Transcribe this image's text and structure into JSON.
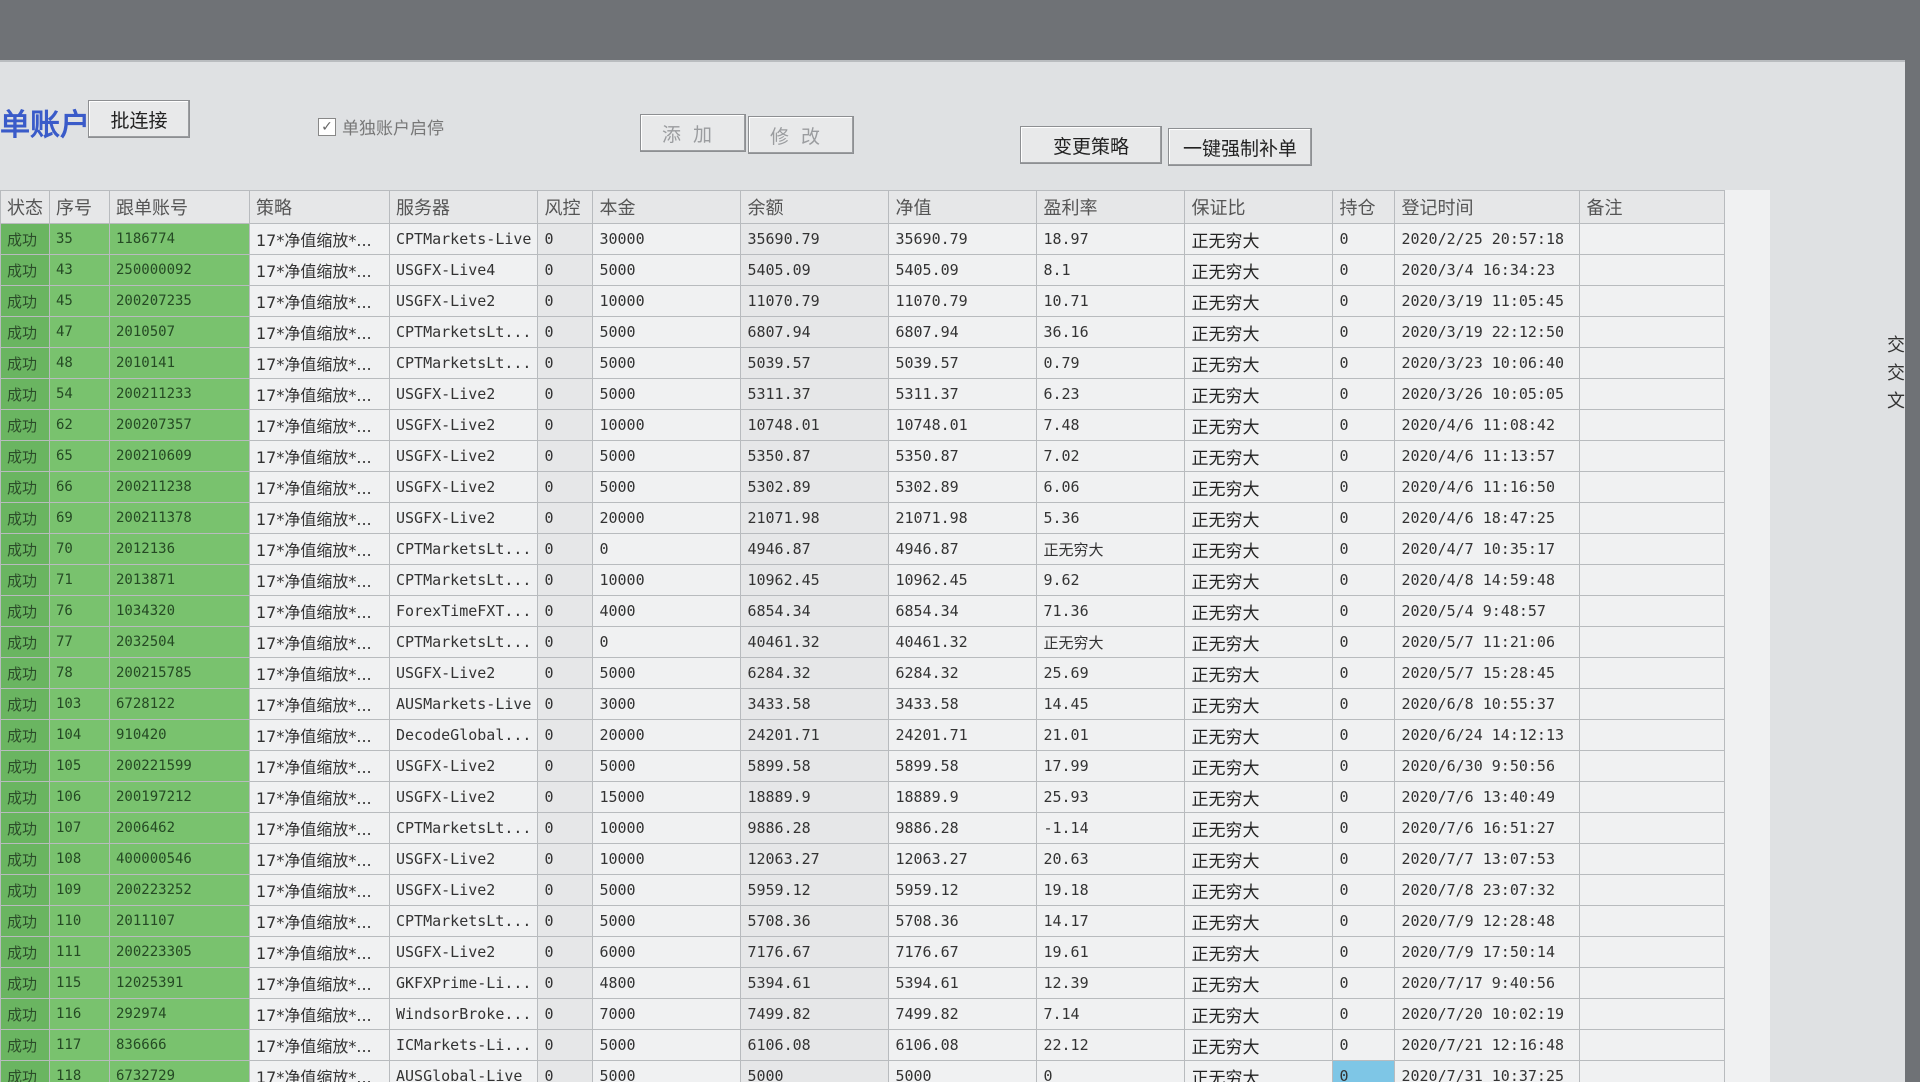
{
  "toolbar": {
    "title": "单账户",
    "batch_connect": "批连接",
    "independent_checkbox": "单独账户启停",
    "checkbox_checked": true,
    "add": "添加",
    "edit": "修改",
    "change_strategy": "变更策略",
    "force_fill": "一键强制补单"
  },
  "columns": [
    "状态",
    "序号",
    "跟单账号",
    "策略",
    "服务器",
    "风控",
    "本金",
    "余额",
    "净值",
    "盈利率",
    "保证比",
    "持仓",
    "登记时间",
    "备注"
  ],
  "rows": [
    {
      "status": "成功",
      "seq": "35",
      "account": "1186774",
      "strategy": "17*净值缩放*...",
      "server": "CPTMarkets-Live",
      "risk": "0",
      "principal": "30000",
      "balance": "35690.79",
      "equity": "35690.79",
      "profit": "18.97",
      "margin": "正无穷大",
      "pos": "0",
      "time": "2020/2/25 20:57:18",
      "note": ""
    },
    {
      "status": "成功",
      "seq": "43",
      "account": "250000092",
      "strategy": "17*净值缩放*...",
      "server": "USGFX-Live4",
      "risk": "0",
      "principal": "5000",
      "balance": "5405.09",
      "equity": "5405.09",
      "profit": "8.1",
      "margin": "正无穷大",
      "pos": "0",
      "time": "2020/3/4 16:34:23",
      "note": ""
    },
    {
      "status": "成功",
      "seq": "45",
      "account": "200207235",
      "strategy": "17*净值缩放*...",
      "server": "USGFX-Live2",
      "risk": "0",
      "principal": "10000",
      "balance": "11070.79",
      "equity": "11070.79",
      "profit": "10.71",
      "margin": "正无穷大",
      "pos": "0",
      "time": "2020/3/19 11:05:45",
      "note": ""
    },
    {
      "status": "成功",
      "seq": "47",
      "account": "2010507",
      "strategy": "17*净值缩放*...",
      "server": "CPTMarketsLt...",
      "risk": "0",
      "principal": "5000",
      "balance": "6807.94",
      "equity": "6807.94",
      "profit": "36.16",
      "margin": "正无穷大",
      "pos": "0",
      "time": "2020/3/19 22:12:50",
      "note": ""
    },
    {
      "status": "成功",
      "seq": "48",
      "account": "2010141",
      "strategy": "17*净值缩放*...",
      "server": "CPTMarketsLt...",
      "risk": "0",
      "principal": "5000",
      "balance": "5039.57",
      "equity": "5039.57",
      "profit": "0.79",
      "margin": "正无穷大",
      "pos": "0",
      "time": "2020/3/23 10:06:40",
      "note": ""
    },
    {
      "status": "成功",
      "seq": "54",
      "account": "200211233",
      "strategy": "17*净值缩放*...",
      "server": "USGFX-Live2",
      "risk": "0",
      "principal": "5000",
      "balance": "5311.37",
      "equity": "5311.37",
      "profit": "6.23",
      "margin": "正无穷大",
      "pos": "0",
      "time": "2020/3/26 10:05:05",
      "note": ""
    },
    {
      "status": "成功",
      "seq": "62",
      "account": "200207357",
      "strategy": "17*净值缩放*...",
      "server": "USGFX-Live2",
      "risk": "0",
      "principal": "10000",
      "balance": "10748.01",
      "equity": "10748.01",
      "profit": "7.48",
      "margin": "正无穷大",
      "pos": "0",
      "time": "2020/4/6 11:08:42",
      "note": ""
    },
    {
      "status": "成功",
      "seq": "65",
      "account": "200210609",
      "strategy": "17*净值缩放*...",
      "server": "USGFX-Live2",
      "risk": "0",
      "principal": "5000",
      "balance": "5350.87",
      "equity": "5350.87",
      "profit": "7.02",
      "margin": "正无穷大",
      "pos": "0",
      "time": "2020/4/6 11:13:57",
      "note": ""
    },
    {
      "status": "成功",
      "seq": "66",
      "account": "200211238",
      "strategy": "17*净值缩放*...",
      "server": "USGFX-Live2",
      "risk": "0",
      "principal": "5000",
      "balance": "5302.89",
      "equity": "5302.89",
      "profit": "6.06",
      "margin": "正无穷大",
      "pos": "0",
      "time": "2020/4/6 11:16:50",
      "note": ""
    },
    {
      "status": "成功",
      "seq": "69",
      "account": "200211378",
      "strategy": "17*净值缩放*...",
      "server": "USGFX-Live2",
      "risk": "0",
      "principal": "20000",
      "balance": "21071.98",
      "equity": "21071.98",
      "profit": "5.36",
      "margin": "正无穷大",
      "pos": "0",
      "time": "2020/4/6 18:47:25",
      "note": ""
    },
    {
      "status": "成功",
      "seq": "70",
      "account": "2012136",
      "strategy": "17*净值缩放*...",
      "server": "CPTMarketsLt...",
      "risk": "0",
      "principal": "0",
      "balance": "4946.87",
      "equity": "4946.87",
      "profit": "正无穷大",
      "margin": "正无穷大",
      "pos": "0",
      "time": "2020/4/7 10:35:17",
      "note": ""
    },
    {
      "status": "成功",
      "seq": "71",
      "account": "2013871",
      "strategy": "17*净值缩放*...",
      "server": "CPTMarketsLt...",
      "risk": "0",
      "principal": "10000",
      "balance": "10962.45",
      "equity": "10962.45",
      "profit": "9.62",
      "margin": "正无穷大",
      "pos": "0",
      "time": "2020/4/8 14:59:48",
      "note": ""
    },
    {
      "status": "成功",
      "seq": "76",
      "account": "1034320",
      "strategy": "17*净值缩放*...",
      "server": "ForexTimeFXT...",
      "risk": "0",
      "principal": "4000",
      "balance": "6854.34",
      "equity": "6854.34",
      "profit": "71.36",
      "margin": "正无穷大",
      "pos": "0",
      "time": "2020/5/4 9:48:57",
      "note": ""
    },
    {
      "status": "成功",
      "seq": "77",
      "account": "2032504",
      "strategy": "17*净值缩放*...",
      "server": "CPTMarketsLt...",
      "risk": "0",
      "principal": "0",
      "balance": "40461.32",
      "equity": "40461.32",
      "profit": "正无穷大",
      "margin": "正无穷大",
      "pos": "0",
      "time": "2020/5/7 11:21:06",
      "note": ""
    },
    {
      "status": "成功",
      "seq": "78",
      "account": "200215785",
      "strategy": "17*净值缩放*...",
      "server": "USGFX-Live2",
      "risk": "0",
      "principal": "5000",
      "balance": "6284.32",
      "equity": "6284.32",
      "profit": "25.69",
      "margin": "正无穷大",
      "pos": "0",
      "time": "2020/5/7 15:28:45",
      "note": ""
    },
    {
      "status": "成功",
      "seq": "103",
      "account": "6728122",
      "strategy": "17*净值缩放*...",
      "server": "AUSMarkets-Live",
      "risk": "0",
      "principal": "3000",
      "balance": "3433.58",
      "equity": "3433.58",
      "profit": "14.45",
      "margin": "正无穷大",
      "pos": "0",
      "time": "2020/6/8 10:55:37",
      "note": ""
    },
    {
      "status": "成功",
      "seq": "104",
      "account": "910420",
      "strategy": "17*净值缩放*...",
      "server": "DecodeGlobal...",
      "risk": "0",
      "principal": "20000",
      "balance": "24201.71",
      "equity": "24201.71",
      "profit": "21.01",
      "margin": "正无穷大",
      "pos": "0",
      "time": "2020/6/24 14:12:13",
      "note": ""
    },
    {
      "status": "成功",
      "seq": "105",
      "account": "200221599",
      "strategy": "17*净值缩放*...",
      "server": "USGFX-Live2",
      "risk": "0",
      "principal": "5000",
      "balance": "5899.58",
      "equity": "5899.58",
      "profit": "17.99",
      "margin": "正无穷大",
      "pos": "0",
      "time": "2020/6/30 9:50:56",
      "note": ""
    },
    {
      "status": "成功",
      "seq": "106",
      "account": "200197212",
      "strategy": "17*净值缩放*...",
      "server": "USGFX-Live2",
      "risk": "0",
      "principal": "15000",
      "balance": "18889.9",
      "equity": "18889.9",
      "profit": "25.93",
      "margin": "正无穷大",
      "pos": "0",
      "time": "2020/7/6 13:40:49",
      "note": ""
    },
    {
      "status": "成功",
      "seq": "107",
      "account": "2006462",
      "strategy": "17*净值缩放*...",
      "server": "CPTMarketsLt...",
      "risk": "0",
      "principal": "10000",
      "balance": "9886.28",
      "equity": "9886.28",
      "profit": "-1.14",
      "margin": "正无穷大",
      "pos": "0",
      "time": "2020/7/6 16:51:27",
      "note": ""
    },
    {
      "status": "成功",
      "seq": "108",
      "account": "400000546",
      "strategy": "17*净值缩放*...",
      "server": "USGFX-Live2",
      "risk": "0",
      "principal": "10000",
      "balance": "12063.27",
      "equity": "12063.27",
      "profit": "20.63",
      "margin": "正无穷大",
      "pos": "0",
      "time": "2020/7/7 13:07:53",
      "note": ""
    },
    {
      "status": "成功",
      "seq": "109",
      "account": "200223252",
      "strategy": "17*净值缩放*...",
      "server": "USGFX-Live2",
      "risk": "0",
      "principal": "5000",
      "balance": "5959.12",
      "equity": "5959.12",
      "profit": "19.18",
      "margin": "正无穷大",
      "pos": "0",
      "time": "2020/7/8 23:07:32",
      "note": ""
    },
    {
      "status": "成功",
      "seq": "110",
      "account": "2011107",
      "strategy": "17*净值缩放*...",
      "server": "CPTMarketsLt...",
      "risk": "0",
      "principal": "5000",
      "balance": "5708.36",
      "equity": "5708.36",
      "profit": "14.17",
      "margin": "正无穷大",
      "pos": "0",
      "time": "2020/7/9 12:28:48",
      "note": ""
    },
    {
      "status": "成功",
      "seq": "111",
      "account": "200223305",
      "strategy": "17*净值缩放*...",
      "server": "USGFX-Live2",
      "risk": "0",
      "principal": "6000",
      "balance": "7176.67",
      "equity": "7176.67",
      "profit": "19.61",
      "margin": "正无穷大",
      "pos": "0",
      "time": "2020/7/9 17:50:14",
      "note": ""
    },
    {
      "status": "成功",
      "seq": "115",
      "account": "12025391",
      "strategy": "17*净值缩放*...",
      "server": "GKFXPrime-Li...",
      "risk": "0",
      "principal": "4800",
      "balance": "5394.61",
      "equity": "5394.61",
      "profit": "12.39",
      "margin": "正无穷大",
      "pos": "0",
      "time": "2020/7/17 9:40:56",
      "note": ""
    },
    {
      "status": "成功",
      "seq": "116",
      "account": "292974",
      "strategy": "17*净值缩放*...",
      "server": "WindsorBroke...",
      "risk": "0",
      "principal": "7000",
      "balance": "7499.82",
      "equity": "7499.82",
      "profit": "7.14",
      "margin": "正无穷大",
      "pos": "0",
      "time": "2020/7/20 10:02:19",
      "note": ""
    },
    {
      "status": "成功",
      "seq": "117",
      "account": "836666",
      "strategy": "17*净值缩放*...",
      "server": "ICMarkets-Li...",
      "risk": "0",
      "principal": "5000",
      "balance": "6106.08",
      "equity": "6106.08",
      "profit": "22.12",
      "margin": "正无穷大",
      "pos": "0",
      "time": "2020/7/21 12:16:48",
      "note": ""
    },
    {
      "status": "成功",
      "seq": "118",
      "account": "6732729",
      "strategy": "17*净值缩放*...",
      "server": "AUSGlobal-Live",
      "risk": "0",
      "principal": "5000",
      "balance": "5000",
      "equity": "5000",
      "profit": "0",
      "margin": "正无穷大",
      "pos": "0",
      "time": "2020/7/31 10:37:25",
      "note": ""
    }
  ],
  "side_text": "交交文"
}
